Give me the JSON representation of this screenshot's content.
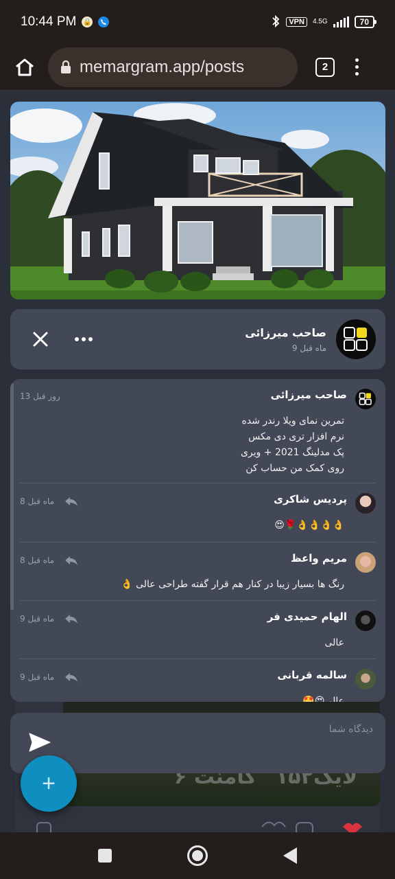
{
  "status_bar": {
    "time": "10:44 PM",
    "vpn": "VPN",
    "network": "4.5G",
    "battery": "70"
  },
  "browser": {
    "url": "memargram.app/posts",
    "tab_count": "2"
  },
  "author": {
    "name": "صاحب میرزائی",
    "time": "9 ماه قبل"
  },
  "comments": [
    {
      "name": "صاحب میرزائی",
      "time": "13 روز قبل",
      "lines": [
        "تمرین نمای ویلا رندر شده",
        "نرم افزار تری دی مکس",
        "پک مدلینگ 2021 + ویری",
        "روی کمک من حساب کن"
      ]
    },
    {
      "name": "پردیس شاکری",
      "time": "8 ماه قبل",
      "text": "👌👌👌👌🌹😍"
    },
    {
      "name": "مریم واعظ",
      "time": "8 ماه قبل",
      "text": "رنگ ها بسیار زیبا در کنار هم قرار گفته طراحی عالی 👌"
    },
    {
      "name": "الهام حمیدی فر",
      "time": "9 ماه قبل",
      "text": "عالی"
    },
    {
      "name": "سالمه قربانی",
      "time": "9 ماه قبل",
      "text": "عالی😍🤩"
    }
  ],
  "comment_input": {
    "placeholder": "دیدگاه شما"
  },
  "background": {
    "likes_text": "۱۵۲لایک",
    "comments_text": "۶ کامنت"
  },
  "fab_label": "+"
}
